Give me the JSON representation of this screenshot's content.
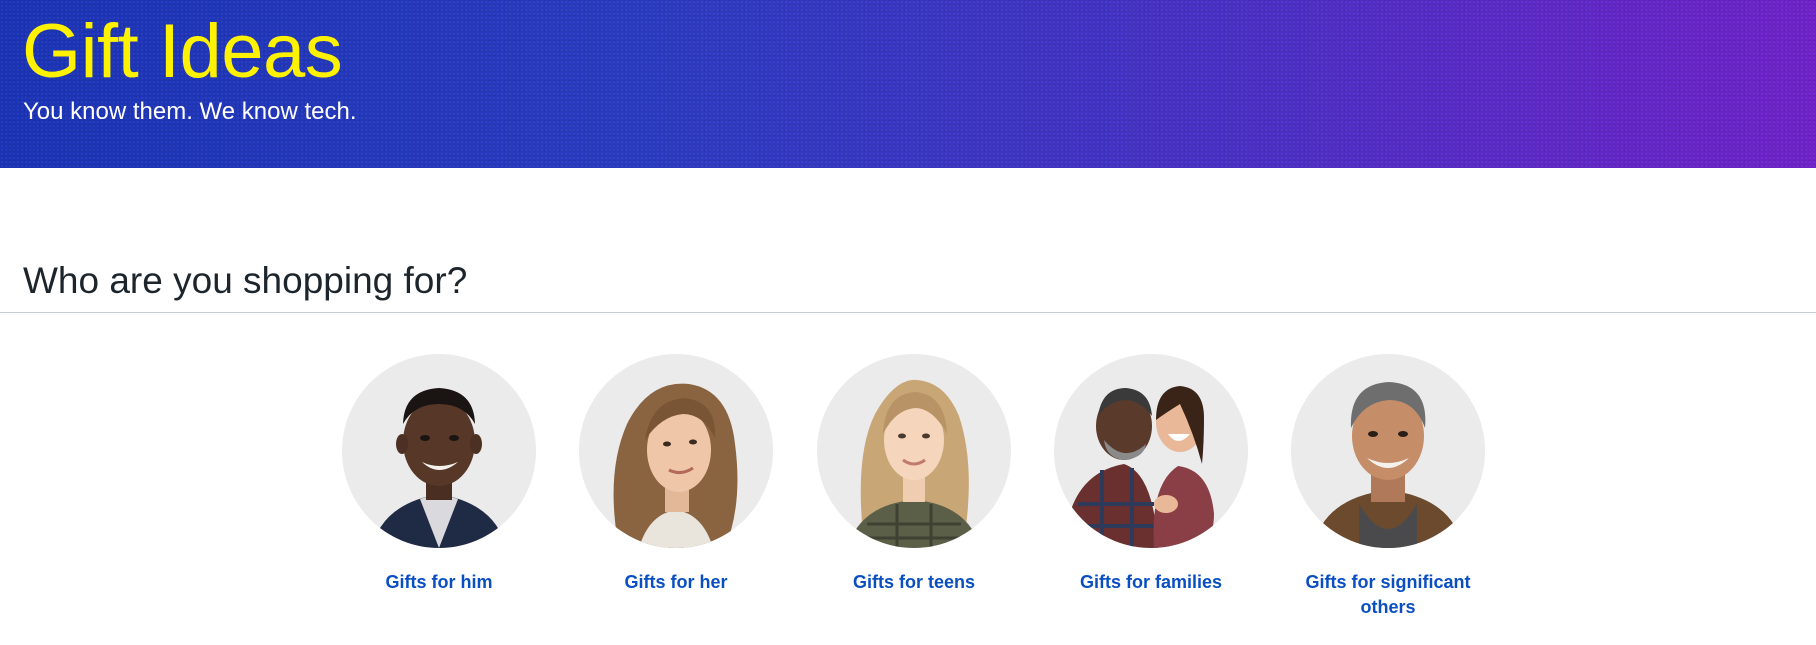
{
  "hero": {
    "title": "Gift Ideas",
    "subtitle": "You know them. We know tech.",
    "gradient_start": "#1b33b5",
    "gradient_end": "#6e22c8",
    "title_color": "#fff200"
  },
  "section": {
    "heading": "Who are you shopping for?"
  },
  "categories": [
    {
      "label": "Gifts for him",
      "image": "young-man-photo"
    },
    {
      "label": "Gifts for her",
      "image": "woman-photo"
    },
    {
      "label": "Gifts for teens",
      "image": "teen-girl-photo"
    },
    {
      "label": "Gifts for families",
      "image": "father-daughter-photo"
    },
    {
      "label": "Gifts for significant others",
      "image": "older-man-photo"
    }
  ],
  "colors": {
    "link": "#0a4fc2",
    "heading": "#1d252c",
    "avatar_bg": "#ebebeb"
  }
}
